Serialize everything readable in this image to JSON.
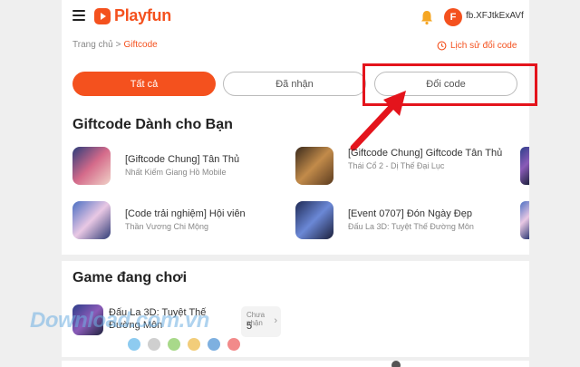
{
  "header": {
    "brand": "Playfun",
    "user_initial": "F",
    "username": "fb.XFJtkExAVf"
  },
  "breadcrumb": {
    "home": "Trang chủ",
    "separator": ">",
    "current": "Giftcode"
  },
  "history_link": "Lịch sử đổi code",
  "tabs": [
    {
      "label": "Tất cả",
      "active": true
    },
    {
      "label": "Đã nhận",
      "active": false
    },
    {
      "label": "Đổi code",
      "active": false
    }
  ],
  "giftcode_section": {
    "title": "Giftcode Dành cho Bạn",
    "items": [
      {
        "title": "[Giftcode Chung] Tân Thủ",
        "game": "Nhất Kiếm Giang Hồ Mobile"
      },
      {
        "title": "[Giftcode Chung] Giftcode Tân Thủ",
        "game": "Thái Cổ 2 - Dị Thế Đại Lục"
      },
      {
        "title": "[Code trải nghiệm] Hội viên",
        "game": "Thần Vương Chi Mộng"
      },
      {
        "title": "[Event 0707] Đón Ngày Đẹp",
        "game": "Đấu La 3D: Tuyệt Thế Đường Môn"
      }
    ]
  },
  "game_section": {
    "title": "Game đang chơi",
    "game": {
      "title": "Đấu La 3D: Tuyệt Thế Đường Môn",
      "status_label": "Chưa nhận",
      "count": "5"
    }
  },
  "watermark": "Download.com.vn",
  "watermark_dot_colors": [
    "#8ecbf0",
    "#cfcfcf",
    "#a8d98a",
    "#f2cd7a",
    "#7eb0e0",
    "#f28a8a"
  ],
  "colors": {
    "accent": "#f4511e",
    "highlight": "#e4141c"
  }
}
